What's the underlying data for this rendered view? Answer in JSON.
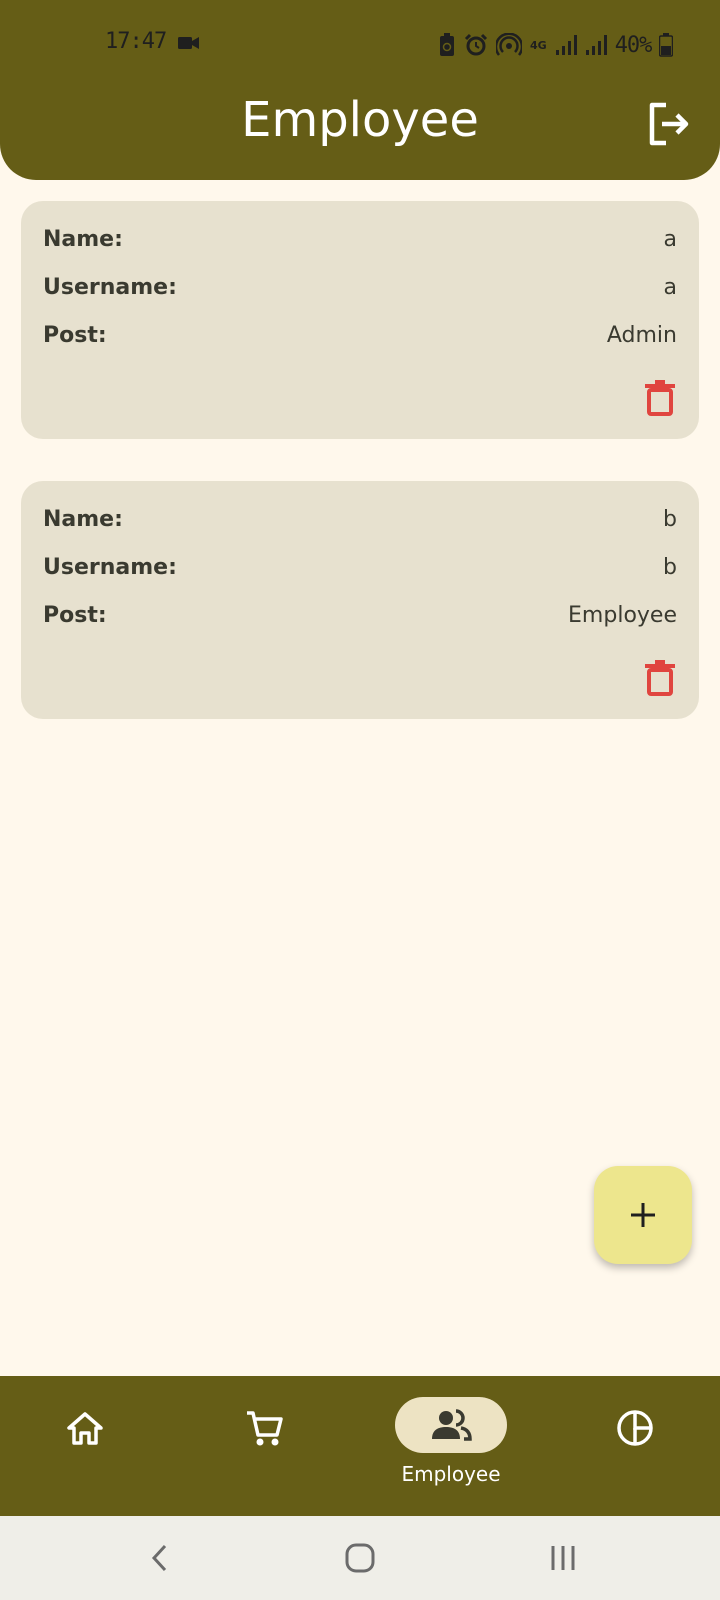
{
  "status_bar": {
    "time": "17:47",
    "battery_percent": "40%",
    "network": "4G",
    "icons": [
      "video-camera-icon",
      "battery-saver-icon",
      "alarm-icon",
      "hotspot-icon",
      "signal-icon",
      "battery-icon"
    ]
  },
  "header": {
    "title": "Employee",
    "logout_icon": "logout-icon"
  },
  "employees": [
    {
      "name_label": "Name:",
      "name": "a",
      "username_label": "Username:",
      "username": "a",
      "post_label": "Post:",
      "post": "Admin",
      "delete_icon": "trash-icon"
    },
    {
      "name_label": "Name:",
      "name": "b",
      "username_label": "Username:",
      "username": "b",
      "post_label": "Post:",
      "post": "Employee",
      "delete_icon": "trash-icon"
    }
  ],
  "fab": {
    "icon": "plus-icon"
  },
  "bottom_nav": {
    "items": [
      {
        "icon": "home-icon",
        "label": ""
      },
      {
        "icon": "cart-icon",
        "label": ""
      },
      {
        "icon": "people-icon",
        "label": "Employee",
        "active": true
      },
      {
        "icon": "pie-chart-icon",
        "label": ""
      }
    ]
  },
  "system_nav": {
    "icons": [
      "back-icon",
      "home-circle-icon",
      "recents-icon"
    ]
  },
  "colors": {
    "header": "#655d16",
    "background": "#fff8ec",
    "card": "#e7e1cf",
    "delete": "#e0453f",
    "fab": "#ede68d",
    "nav_pill": "#ede3c3"
  }
}
